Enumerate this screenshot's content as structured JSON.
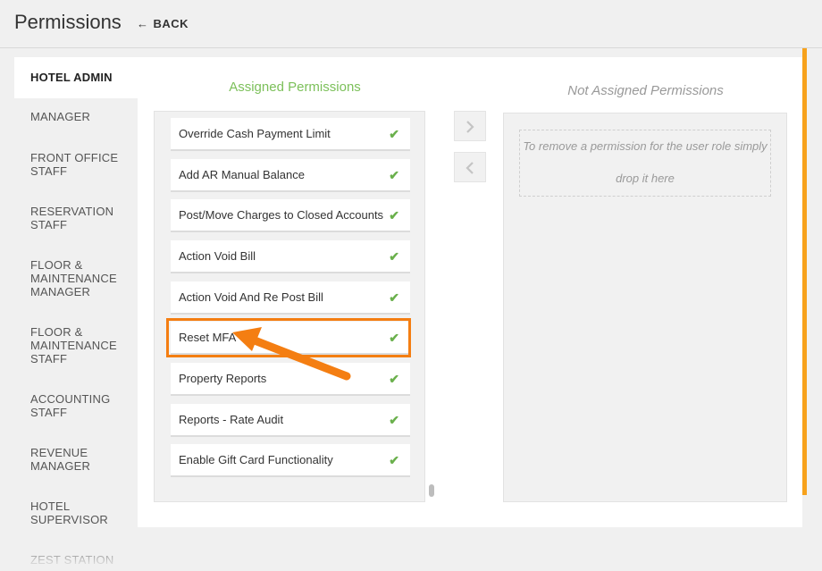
{
  "header": {
    "title": "Permissions",
    "back_label": "BACK"
  },
  "sidebar": {
    "items": [
      {
        "lines": [
          "HOTEL ADMIN"
        ],
        "active": true
      },
      {
        "lines": [
          "MANAGER"
        ]
      },
      {
        "lines": [
          "FRONT OFFICE",
          "STAFF"
        ]
      },
      {
        "lines": [
          "RESERVATION",
          "STAFF"
        ]
      },
      {
        "lines": [
          "FLOOR &",
          "MAINTENANCE",
          "MANAGER"
        ]
      },
      {
        "lines": [
          "FLOOR &",
          "MAINTENANCE",
          "STAFF"
        ]
      },
      {
        "lines": [
          "ACCOUNTING",
          "STAFF"
        ]
      },
      {
        "lines": [
          "REVENUE",
          "MANAGER"
        ]
      },
      {
        "lines": [
          "HOTEL",
          "SUPERVISOR"
        ]
      },
      {
        "lines": [
          "ZEST STATION"
        ]
      }
    ]
  },
  "assigned": {
    "heading": "Assigned Permissions",
    "items": [
      "Override Cash Payment Limit",
      "Add AR Manual Balance",
      "Post/Move Charges to Closed Accounts",
      "Action Void Bill",
      "Action Void And Re Post Bill",
      "Reset MFA",
      "Property Reports",
      "Reports - Rate Audit",
      "Enable Gift Card Functionality"
    ]
  },
  "unassigned": {
    "heading": "Not Assigned Permissions",
    "drop_hint_line1": "To remove a permission for the user role simply",
    "drop_hint_line2": "drop it here"
  },
  "colors": {
    "accent": "#f7a21c",
    "assigned_heading": "#7cc05a",
    "check": "#6ab04c",
    "annotation": "#f47e12"
  }
}
